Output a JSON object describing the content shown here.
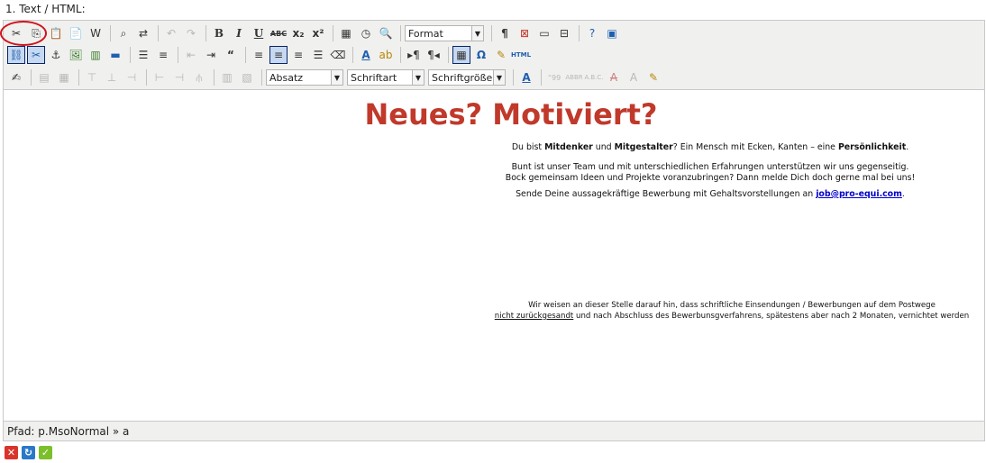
{
  "field_label": "1. Text / HTML:",
  "toolbar": {
    "format_select": "Format",
    "paragraph_select": "Absatz",
    "font_select": "Schriftart",
    "size_select": "Schriftgröße",
    "html_button": "HTML"
  },
  "content": {
    "heading": "Neues? Motiviert?",
    "p1_a": "Du bist ",
    "p1_b": "Mitdenker",
    "p1_c": " und ",
    "p1_d": "Mitgestalter",
    "p1_e": "? Ein Mensch mit Ecken, Kanten – eine ",
    "p1_f": "Persönlichkeit",
    "p1_g": ".",
    "p2_line1": "Bunt ist unser Team und mit unterschiedlichen Erfahrungen unterstützen wir uns gegenseitig.",
    "p2_line2": "Bock gemeinsam Ideen und Projekte voranzubringen? Dann melde Dich doch gerne mal bei uns!",
    "p3_text": "Sende Deine aussagekräftige Bewerbung mit Gehaltsvorstellungen an ",
    "p3_email": "job@pro-equi.com",
    "p3_end": ".",
    "fine_line1": "Wir weisen an dieser Stelle darauf hin, dass schriftliche Einsendungen / Bewerbungen auf dem Postwege",
    "fine_underlined": "nicht zurückgesandt",
    "fine_line2_rest": " und nach Abschluss des Bewerbunsgverfahrens, spätestens aber nach 2 Monaten, vernichtet werden"
  },
  "status": {
    "path": "Pfad: p.MsoNormal » a"
  },
  "colors": {
    "heading": "#c0392b",
    "link": "#0000cc",
    "highlight_circle": "#d0121c"
  }
}
